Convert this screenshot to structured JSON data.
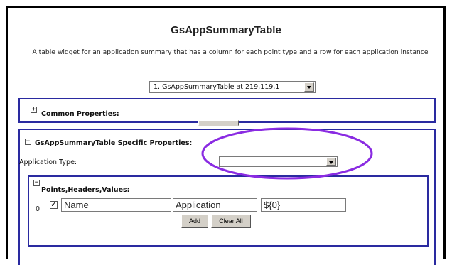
{
  "page": {
    "title": "GsAppSummaryTable",
    "description": "A table widget for an application summary that has a column for each point type and a row for each application instance",
    "instance_select": {
      "selected": "1. GsAppSummaryTable at 219,119,1"
    }
  },
  "common_section": {
    "expander": "+",
    "label": "Common Properties:"
  },
  "specific_section": {
    "expander": "−",
    "label": "GsAppSummaryTable Specific Properties:",
    "app_type_label": "Application Type:",
    "app_type_value": ""
  },
  "points_section": {
    "expander": "−",
    "label": "Points,Headers,Values:",
    "row": {
      "index": "0.",
      "checked": true,
      "field1": "Name",
      "field2": "Application",
      "field3": "${0}"
    },
    "add_button": "Add",
    "clear_button": "Clear All"
  },
  "colors": {
    "panel_border": "#2a2aa0",
    "highlight_ellipse": "#8a2be2"
  }
}
